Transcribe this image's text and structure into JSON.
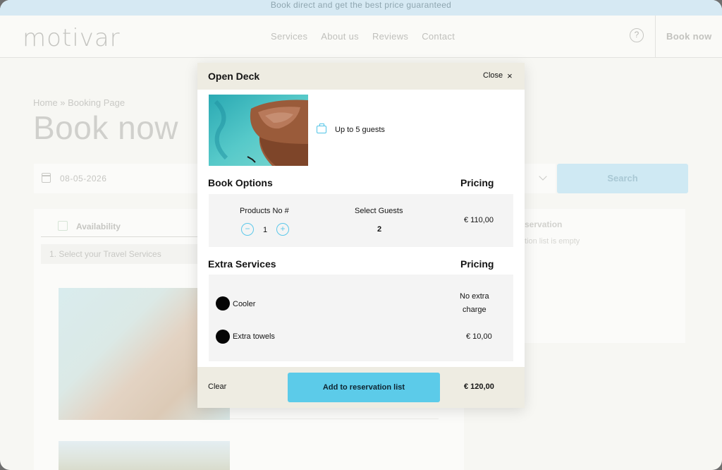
{
  "promo": {
    "text": "Book direct and get the best price guaranteed"
  },
  "header": {
    "logo": "motivar",
    "nav": [
      "Services",
      "About us",
      "Reviews",
      "Contact"
    ],
    "help_icon": "question-circle-icon",
    "book_now": "Book now"
  },
  "page": {
    "breadcrumb": "Home » Booking Page",
    "title": "Book now",
    "search": {
      "date": "08-05-2026",
      "button": "Search"
    },
    "availability_tab": "Availability",
    "step": "1.  Select your Travel Services",
    "reservation": {
      "title": "servation",
      "empty": "tion list is empty"
    }
  },
  "modal": {
    "title": "Open Deck",
    "close_label": "Close",
    "guests": "Up to 5 guests",
    "book_options": {
      "title": "Book Options",
      "pricing": "Pricing",
      "products_label": "Products No #",
      "products_qty": "1",
      "minus": "−",
      "plus": "+",
      "guests_label": "Select Guests",
      "guests_value": "2",
      "price": "€ 110,00"
    },
    "extra_services": {
      "title": "Extra Services",
      "pricing": "Pricing",
      "items": [
        {
          "label": "Cooler",
          "price_line1": "No extra",
          "price_line2": "charge"
        },
        {
          "label": "Extra towels",
          "price": "€ 10,00"
        }
      ]
    },
    "footer": {
      "clear": "Clear",
      "add": "Add to reservation list",
      "total": "€ 120,00"
    }
  },
  "colors": {
    "accent": "#5ccbe9",
    "modal_header": "#eeece2"
  }
}
